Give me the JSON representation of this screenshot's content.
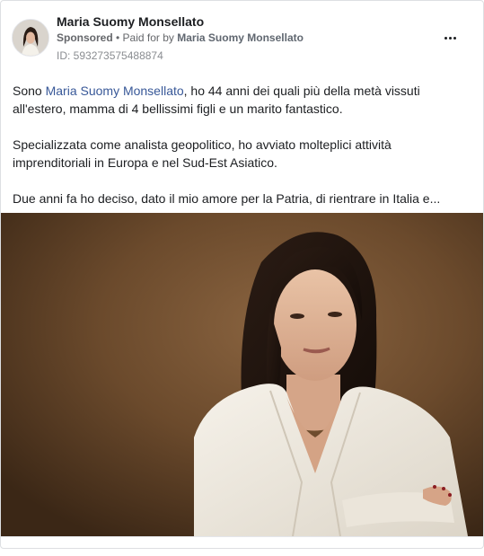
{
  "post": {
    "author_name": "Maria Suomy Monsellato",
    "sponsored_label": "Sponsored",
    "paid_prefix": " • Paid for by ",
    "paid_by": "Maria Suomy Monsellato",
    "ad_id": "ID: 593273575488874",
    "more_icon": "more-options-icon"
  },
  "text": {
    "p1_before": "Sono ",
    "p1_link": "Maria Suomy Monsellato",
    "p1_after": ", ho 44 anni dei quali più della metà vissuti all'estero, mamma di 4 bellissimi figli e un marito fantastico.",
    "p2": "Specializzata come analista geopolitico, ho avviato molteplici attività imprenditoriali in Europa e nel Sud-Est Asiatico.",
    "p3": "Due anni fa ho deciso, dato il mio amore per la Patria, di rientrare in Italia e..."
  },
  "colors": {
    "link": "#385898",
    "background_photo": "#6b4a2c",
    "jacket": "#efeae0"
  }
}
